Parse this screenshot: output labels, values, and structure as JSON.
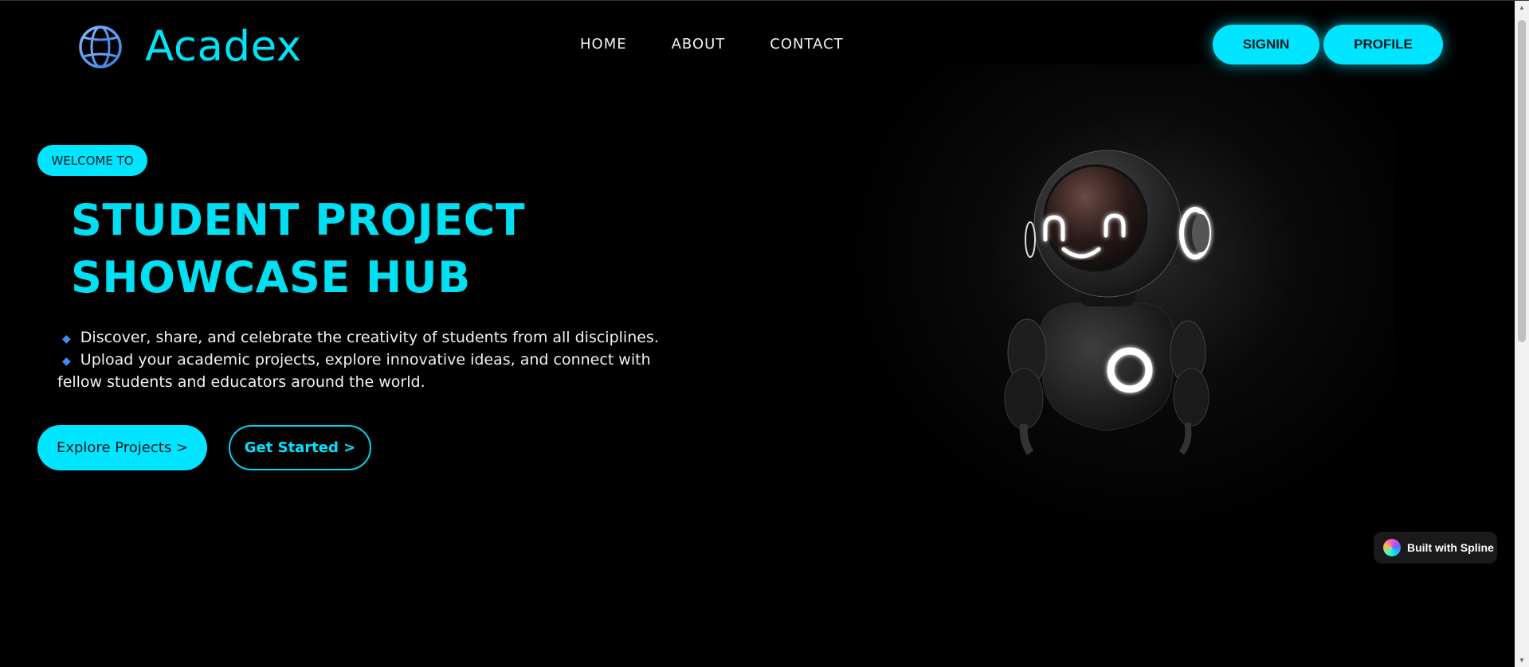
{
  "header": {
    "brand": "Acadex",
    "logo_icon": "globe-icon",
    "nav": [
      {
        "label": "HOME"
      },
      {
        "label": "ABOUT"
      },
      {
        "label": "CONTACT"
      }
    ],
    "signin_label": "SIGNIN",
    "profile_label": "PROFILE"
  },
  "hero": {
    "badge": "WELCOME TO",
    "title_line1": "STUDENT PROJECT",
    "title_line2": "SHOWCASE HUB",
    "bullets": [
      "Discover, share, and celebrate the creativity of students from all disciplines.",
      "Upload your academic projects, explore innovative ideas, and connect with fellow students and educators around the world."
    ],
    "primary_button": "Explore Projects >",
    "secondary_button": "Get Started >"
  },
  "spline_badge": "Built with Spline",
  "colors": {
    "accent": "#00e5ff",
    "background": "#000000",
    "bullet": "#3d8df5"
  }
}
